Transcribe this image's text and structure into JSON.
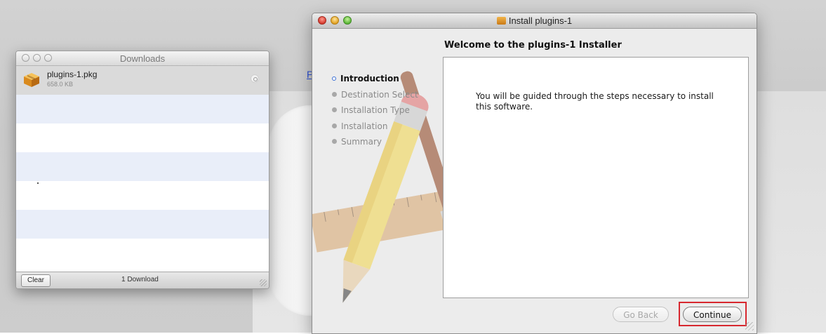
{
  "background": {
    "link_text": "P"
  },
  "downloads_window": {
    "title": "Downloads",
    "items": [
      {
        "name": "plugins-1.pkg",
        "size": "658.0 KB",
        "icon": "package-icon"
      }
    ],
    "clear_label": "Clear",
    "count_label": "1 Download"
  },
  "installer_window": {
    "title": "Install plugins-1",
    "heading": "Welcome to the plugins-1 Installer",
    "steps": [
      {
        "label": "Introduction",
        "active": true
      },
      {
        "label": "Destination Select",
        "active": false
      },
      {
        "label": "Installation Type",
        "active": false
      },
      {
        "label": "Installation",
        "active": false
      },
      {
        "label": "Summary",
        "active": false
      }
    ],
    "body_text": "You will be guided through the steps necessary to install this software.",
    "go_back_label": "Go Back",
    "continue_label": "Continue",
    "highlight_color": "#d7282f"
  }
}
